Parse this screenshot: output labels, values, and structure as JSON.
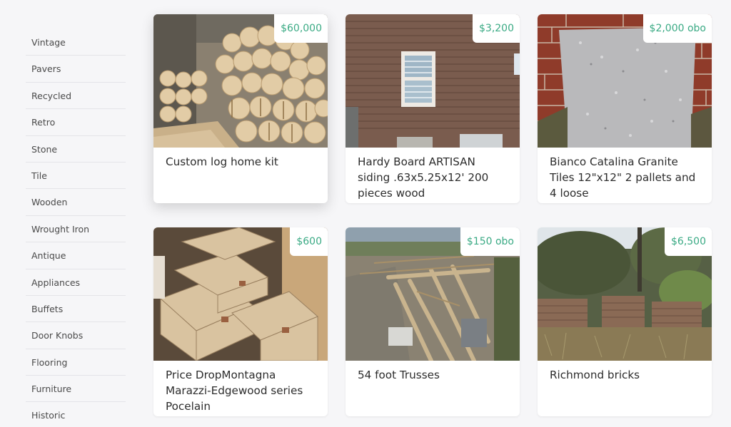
{
  "sidebar": {
    "items": [
      {
        "label": "Vintage"
      },
      {
        "label": "Pavers"
      },
      {
        "label": "Recycled"
      },
      {
        "label": "Retro"
      },
      {
        "label": "Stone"
      },
      {
        "label": "Tile"
      },
      {
        "label": "Wooden"
      },
      {
        "label": "Wrought Iron"
      },
      {
        "label": "Antique"
      },
      {
        "label": "Appliances"
      },
      {
        "label": "Buffets"
      },
      {
        "label": "Door Knobs"
      },
      {
        "label": "Flooring"
      },
      {
        "label": "Furniture"
      },
      {
        "label": "Historic"
      }
    ]
  },
  "listings": [
    {
      "title": "Custom log home kit",
      "price": "$60,000",
      "image": "log-home-kit-photo"
    },
    {
      "title": "Hardy Board ARTISAN siding .63x5.25x12' 200 pieces wood",
      "price": "$3,200",
      "image": "siding-house-wall-photo"
    },
    {
      "title": "Bianco Catalina Granite Tiles 12\"x12\" 2 pallets and 4 loose",
      "price": "$2,000 obo",
      "image": "granite-tile-photo"
    },
    {
      "title": "Price DropMontagna Marazzi-Edgewood series Pocelain",
      "price": "$600",
      "image": "porcelain-tile-boxes-photo"
    },
    {
      "title": "54 foot Trusses",
      "price": "$150 obo",
      "image": "wood-trusses-photo"
    },
    {
      "title": "Richmond bricks",
      "price": "$6,500",
      "image": "brick-pile-photo"
    }
  ],
  "colors": {
    "price": "#3aaa84",
    "background": "#f6f6f8"
  }
}
